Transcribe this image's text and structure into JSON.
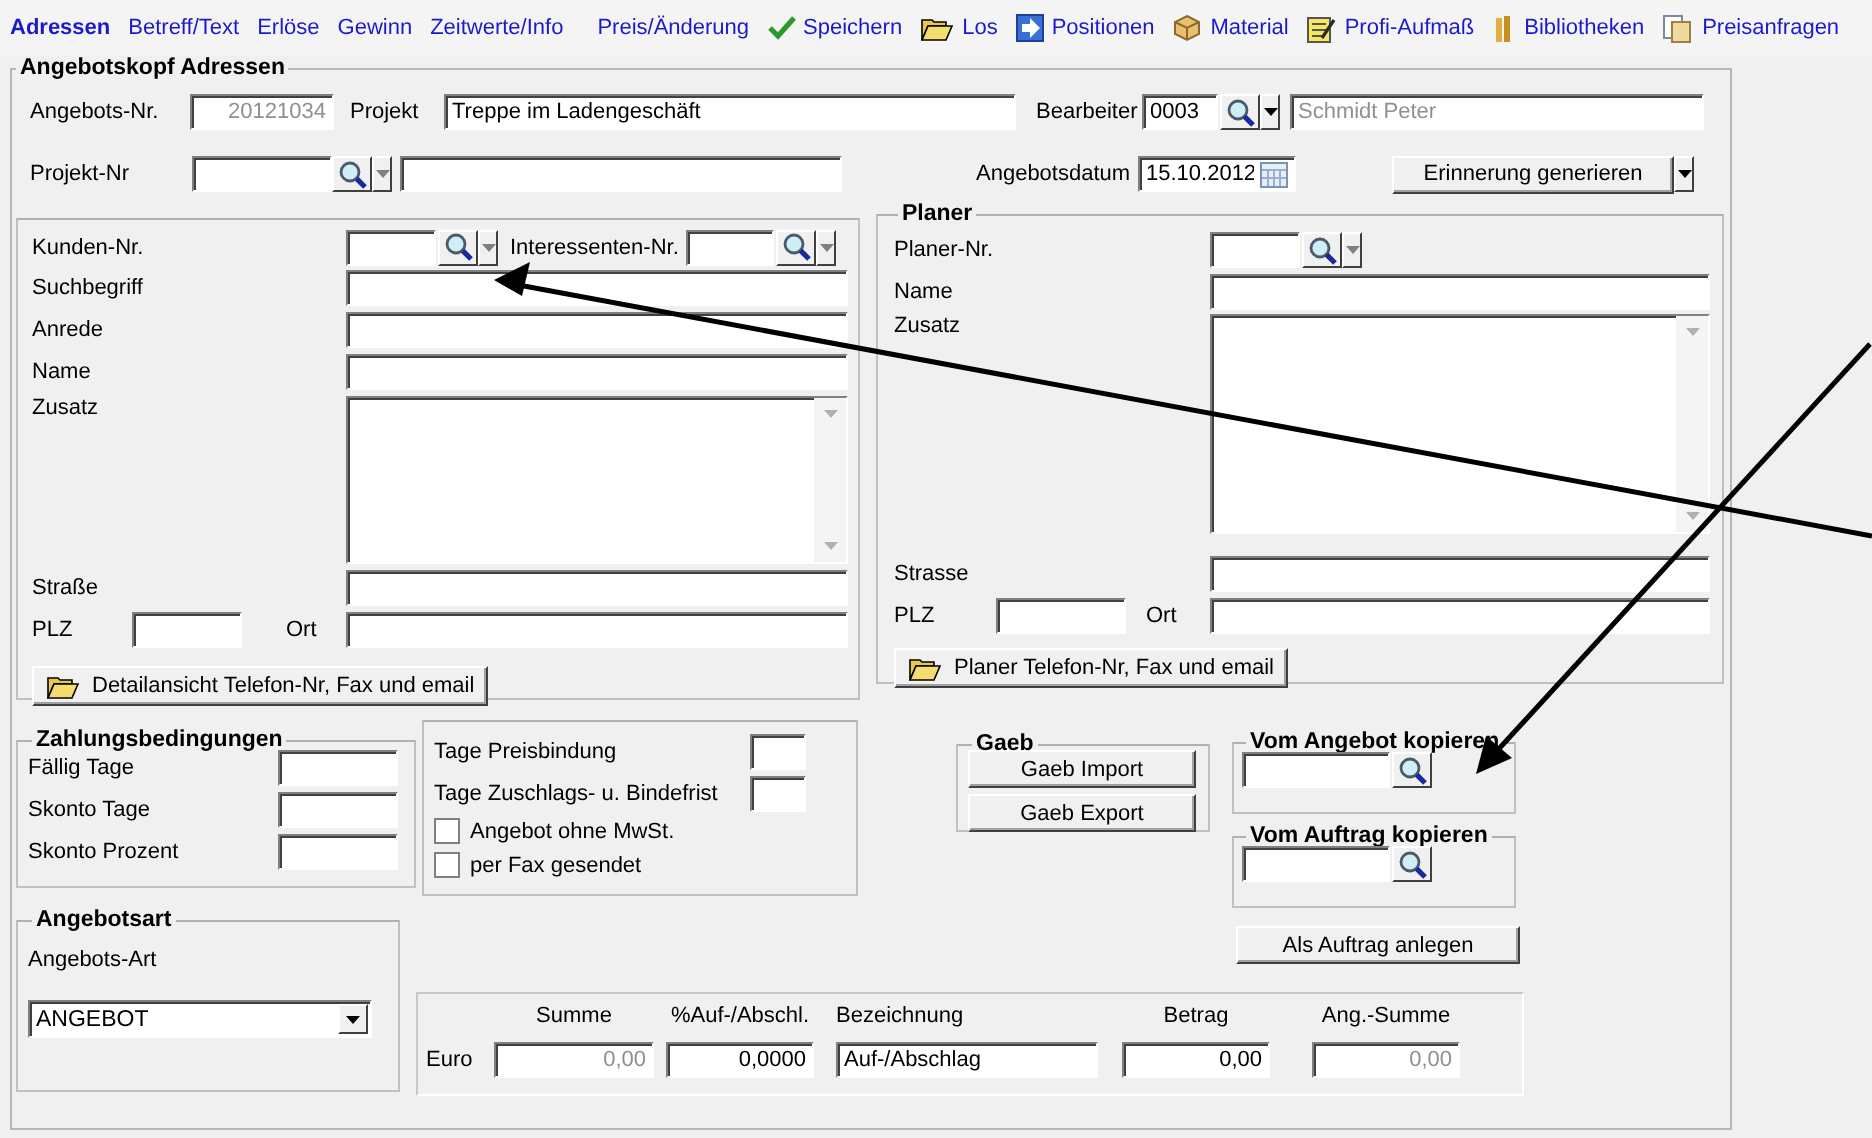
{
  "toolbar": [
    {
      "label": "Adressen",
      "selected": true
    },
    {
      "label": "Betreff/Text",
      "selected": false
    },
    {
      "label": "Erlöse",
      "selected": false
    },
    {
      "label": "Gewinn",
      "selected": false
    },
    {
      "label": "Zeitwerte/Info",
      "selected": false
    },
    {
      "label": "Preis/Änderung",
      "selected": false
    },
    {
      "label": "Speichern",
      "selected": false
    },
    {
      "label": "Los",
      "selected": false
    },
    {
      "label": "Positionen",
      "selected": false
    },
    {
      "label": "Material",
      "selected": false
    },
    {
      "label": "Profi-Aufmaß",
      "selected": false
    },
    {
      "label": "Bibliotheken",
      "selected": false
    },
    {
      "label": "Preisanfragen",
      "selected": false
    }
  ],
  "header": {
    "title": "Angebotskopf Adressen",
    "offer_no": {
      "label": "Angebots-Nr.",
      "value": "20121034",
      "disabled": true
    },
    "project": {
      "label": "Projekt",
      "value": "Treppe im Ladengeschäft",
      "disabled": false
    },
    "editor": {
      "label": "Bearbeiter",
      "code": "0003",
      "name": "Schmidt Peter",
      "disabled": true
    },
    "project_no": {
      "label": "Projekt-Nr"
    },
    "offer_date": {
      "label": "Angebotsdatum",
      "value": "15.10.2012"
    },
    "reminder_button": "Erinnerung generieren"
  },
  "customer": {
    "customer_no_label": "Kunden-Nr.",
    "prospect_no_label": "Interessenten-Nr.",
    "lines": [
      "Suchbegriff",
      "Anrede",
      "Name"
    ],
    "note_label": "Zusatz",
    "street_label": "Straße",
    "zip_label": "PLZ",
    "city_label": "Ort",
    "button": "Detailansicht Telefon-Nr, Fax und email"
  },
  "planner": {
    "title": "Planer",
    "no_label": "Planer-Nr.",
    "name_label": "Name",
    "note_label": "Zusatz",
    "street_label": "Strasse",
    "zip_label": "PLZ",
    "city_label": "Ort",
    "button": "Planer Telefon-Nr, Fax und email"
  },
  "payment": {
    "title": "Zahlungsbedingungen",
    "rows": [
      "Fällig Tage",
      "Skonto Tage",
      "Skonto Prozent"
    ]
  },
  "terms": {
    "fields": [
      "Tage Preisbindung",
      "Tage Zuschlags- u. Bindefrist"
    ],
    "checkboxes": [
      {
        "label": "Angebot ohne MwSt.",
        "checked": false
      },
      {
        "label": "per Fax gesendet",
        "checked": false
      }
    ]
  },
  "gaeb": {
    "title": "Gaeb",
    "buttons": [
      "Gaeb Import",
      "Gaeb Export"
    ]
  },
  "copy_offer": {
    "title": "Vom Angebot kopieren"
  },
  "copy_order": {
    "title": "Vom Auftrag kopieren"
  },
  "create_order_button": "Als Auftrag anlegen",
  "offer_type": {
    "title": "Angebotsart",
    "label": "Angebots-Art",
    "value": "ANGEBOT"
  },
  "totals": {
    "row_label": "Euro",
    "columns": [
      {
        "heading": "Summe",
        "value": "0,00",
        "kind": "number",
        "disabled": true
      },
      {
        "heading": "%Auf-/Abschl.",
        "value": "0,0000",
        "kind": "number",
        "disabled": false
      },
      {
        "heading": "Bezeichnung",
        "value": "Auf-/Abschlag",
        "kind": "text",
        "disabled": false
      },
      {
        "heading": "Betrag",
        "value": "0,00",
        "kind": "number",
        "disabled": false
      },
      {
        "heading": "Ang.-Summe",
        "value": "0,00",
        "kind": "number",
        "disabled": true
      }
    ]
  }
}
